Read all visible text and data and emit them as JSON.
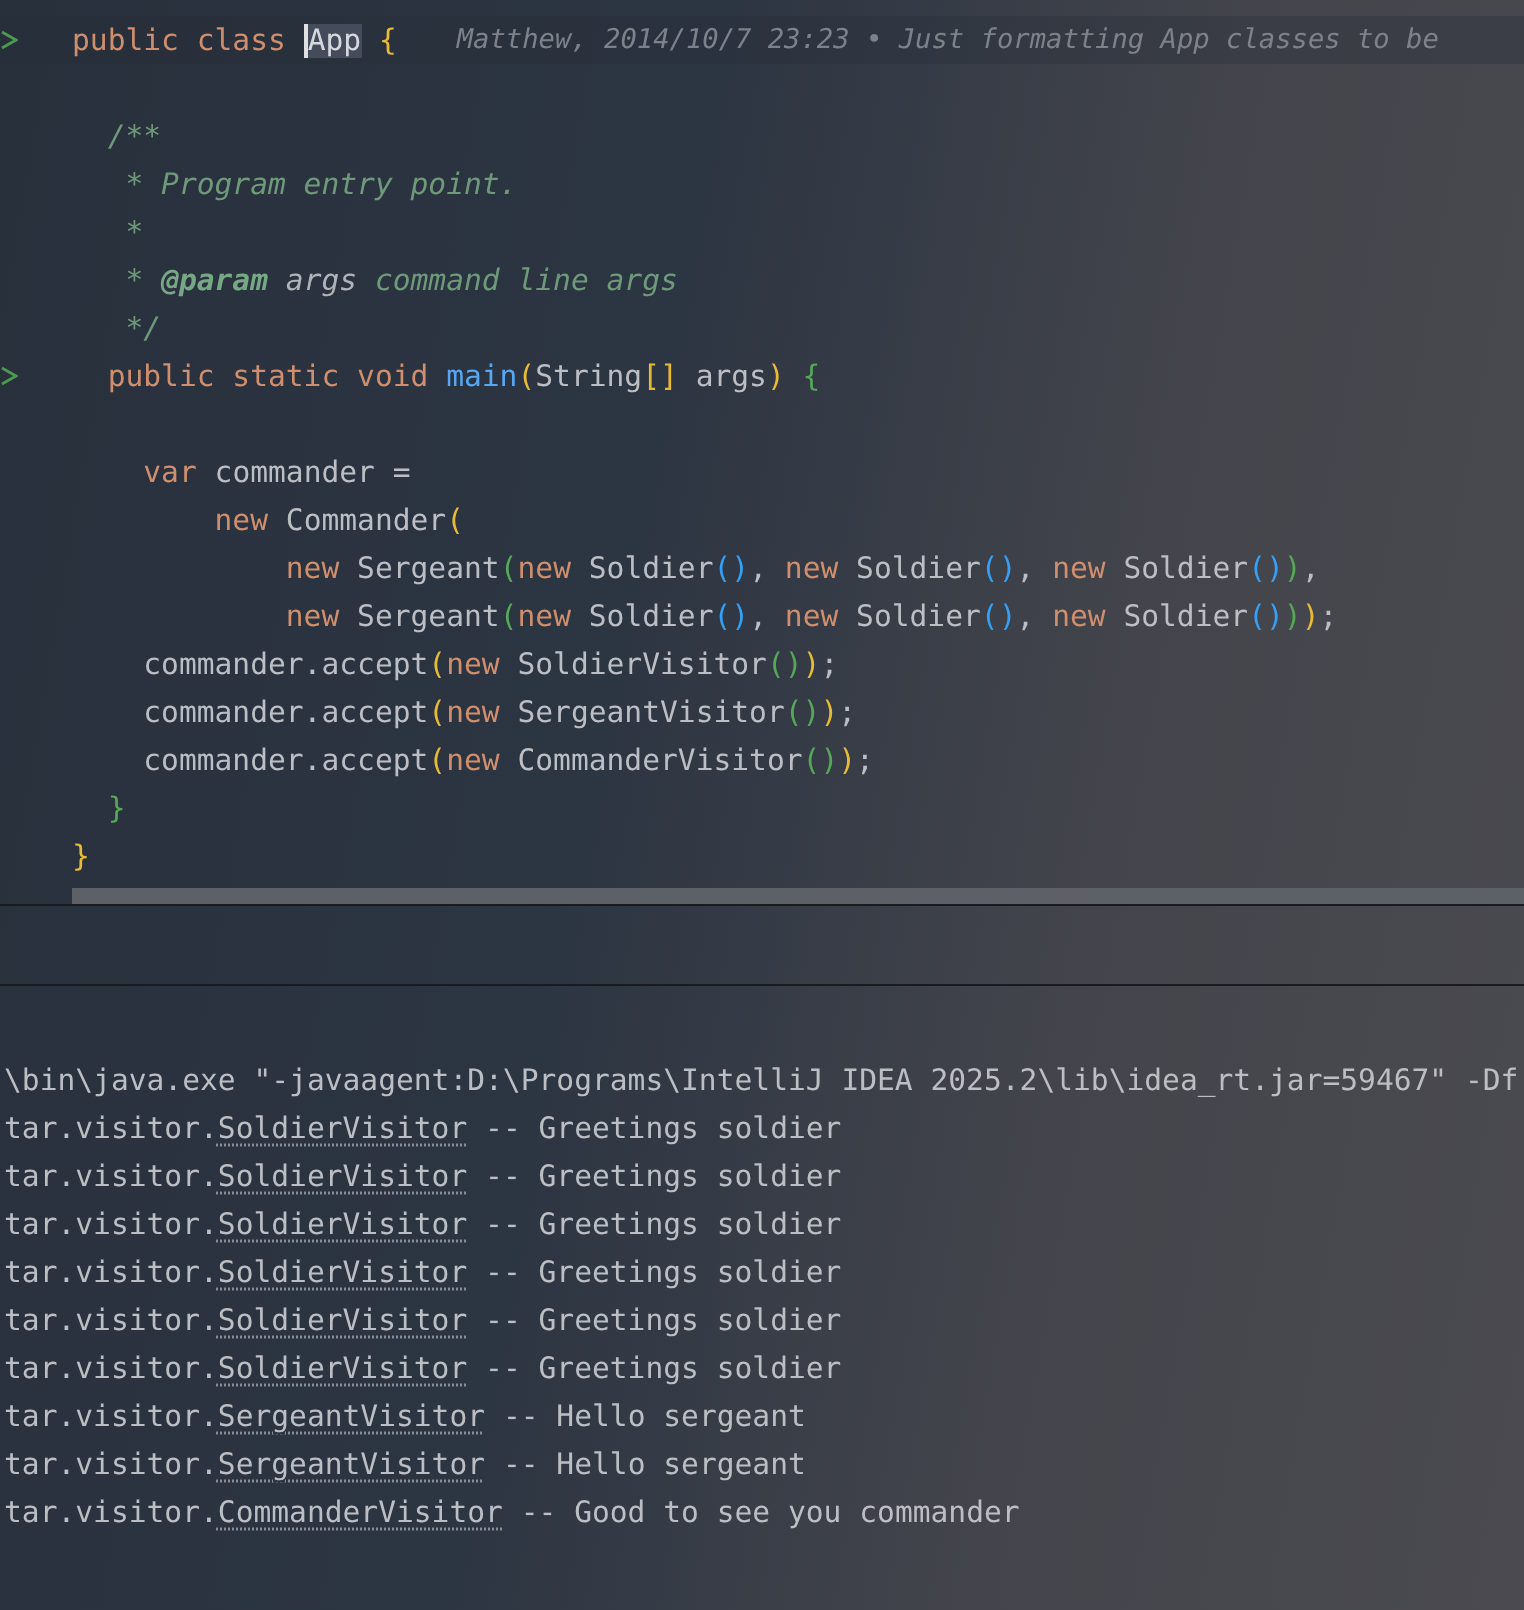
{
  "editor": {
    "lines": [
      {
        "kind": "run-code",
        "tokens": [
          {
            "text": "public class ",
            "kind": "keyword"
          },
          {
            "text": "App",
            "kind": "caret-identifier"
          },
          {
            "text": " {",
            "kind": "bracket-1"
          }
        ],
        "hint": "Matthew, 2014/10/7 23:23 • Just formatting App classes to be"
      },
      {
        "kind": "blank"
      },
      {
        "kind": "code",
        "tokens": [
          {
            "text": "  /**",
            "kind": "doc"
          }
        ]
      },
      {
        "kind": "code",
        "tokens": [
          {
            "text": "   * Program entry point.",
            "kind": "doc"
          }
        ]
      },
      {
        "kind": "code",
        "tokens": [
          {
            "text": "   *",
            "kind": "doc"
          }
        ]
      },
      {
        "kind": "code",
        "tokens": [
          {
            "text": "   * ",
            "kind": "doc"
          },
          {
            "text": "@param",
            "kind": "doc-tag"
          },
          {
            "text": " args",
            "kind": "doc-param"
          },
          {
            "text": " command line args",
            "kind": "doc"
          }
        ]
      },
      {
        "kind": "code",
        "tokens": [
          {
            "text": "   */",
            "kind": "doc"
          }
        ]
      },
      {
        "kind": "run-code",
        "tokens": [
          {
            "text": "  public static void ",
            "kind": "keyword"
          },
          {
            "text": "main",
            "kind": "method"
          },
          {
            "text": "(",
            "kind": "bracket-1"
          },
          {
            "text": "String",
            "kind": "plain"
          },
          {
            "text": "[]",
            "kind": "bracket-1"
          },
          {
            "text": " args",
            "kind": "plain"
          },
          {
            "text": ")",
            "kind": "bracket-1"
          },
          {
            "text": " {",
            "kind": "bracket-2"
          }
        ]
      },
      {
        "kind": "blank"
      },
      {
        "kind": "code",
        "tokens": [
          {
            "text": "    var ",
            "kind": "keyword"
          },
          {
            "text": "commander =",
            "kind": "plain"
          }
        ]
      },
      {
        "kind": "code",
        "tokens": [
          {
            "text": "        new ",
            "kind": "keyword"
          },
          {
            "text": "Commander",
            "kind": "plain"
          },
          {
            "text": "(",
            "kind": "bracket-1"
          }
        ]
      },
      {
        "kind": "code",
        "tokens": [
          {
            "text": "            new ",
            "kind": "keyword"
          },
          {
            "text": "Sergeant",
            "kind": "plain"
          },
          {
            "text": "(",
            "kind": "bracket-2"
          },
          {
            "text": "new ",
            "kind": "keyword"
          },
          {
            "text": "Soldier",
            "kind": "plain"
          },
          {
            "text": "()",
            "kind": "bracket-3"
          },
          {
            "text": ", ",
            "kind": "plain"
          },
          {
            "text": "new ",
            "kind": "keyword"
          },
          {
            "text": "Soldier",
            "kind": "plain"
          },
          {
            "text": "()",
            "kind": "bracket-3"
          },
          {
            "text": ", ",
            "kind": "plain"
          },
          {
            "text": "new ",
            "kind": "keyword"
          },
          {
            "text": "Soldier",
            "kind": "plain"
          },
          {
            "text": "()",
            "kind": "bracket-3"
          },
          {
            "text": ")",
            "kind": "bracket-2"
          },
          {
            "text": ",",
            "kind": "plain"
          }
        ]
      },
      {
        "kind": "code",
        "tokens": [
          {
            "text": "            new ",
            "kind": "keyword"
          },
          {
            "text": "Sergeant",
            "kind": "plain"
          },
          {
            "text": "(",
            "kind": "bracket-2"
          },
          {
            "text": "new ",
            "kind": "keyword"
          },
          {
            "text": "Soldier",
            "kind": "plain"
          },
          {
            "text": "()",
            "kind": "bracket-3"
          },
          {
            "text": ", ",
            "kind": "plain"
          },
          {
            "text": "new ",
            "kind": "keyword"
          },
          {
            "text": "Soldier",
            "kind": "plain"
          },
          {
            "text": "()",
            "kind": "bracket-3"
          },
          {
            "text": ", ",
            "kind": "plain"
          },
          {
            "text": "new ",
            "kind": "keyword"
          },
          {
            "text": "Soldier",
            "kind": "plain"
          },
          {
            "text": "()",
            "kind": "bracket-3"
          },
          {
            "text": ")",
            "kind": "bracket-2"
          },
          {
            "text": ")",
            "kind": "bracket-1"
          },
          {
            "text": ";",
            "kind": "plain"
          }
        ]
      },
      {
        "kind": "code",
        "tokens": [
          {
            "text": "    commander.accept",
            "kind": "plain"
          },
          {
            "text": "(",
            "kind": "bracket-1"
          },
          {
            "text": "new ",
            "kind": "keyword"
          },
          {
            "text": "SoldierVisitor",
            "kind": "plain"
          },
          {
            "text": "()",
            "kind": "bracket-2"
          },
          {
            "text": ")",
            "kind": "bracket-1"
          },
          {
            "text": ";",
            "kind": "plain"
          }
        ]
      },
      {
        "kind": "code",
        "tokens": [
          {
            "text": "    commander.accept",
            "kind": "plain"
          },
          {
            "text": "(",
            "kind": "bracket-1"
          },
          {
            "text": "new ",
            "kind": "keyword"
          },
          {
            "text": "SergeantVisitor",
            "kind": "plain"
          },
          {
            "text": "()",
            "kind": "bracket-2"
          },
          {
            "text": ")",
            "kind": "bracket-1"
          },
          {
            "text": ";",
            "kind": "plain"
          }
        ]
      },
      {
        "kind": "code",
        "tokens": [
          {
            "text": "    commander.accept",
            "kind": "plain"
          },
          {
            "text": "(",
            "kind": "bracket-1"
          },
          {
            "text": "new ",
            "kind": "keyword"
          },
          {
            "text": "CommanderVisitor",
            "kind": "plain"
          },
          {
            "text": "()",
            "kind": "bracket-2"
          },
          {
            "text": ")",
            "kind": "bracket-1"
          },
          {
            "text": ";",
            "kind": "plain"
          }
        ]
      },
      {
        "kind": "code",
        "tokens": [
          {
            "text": "  }",
            "kind": "bracket-2"
          }
        ]
      },
      {
        "kind": "code",
        "tokens": [
          {
            "text": "}",
            "kind": "bracket-1"
          }
        ]
      }
    ]
  },
  "console": {
    "lines": [
      {
        "kind": "command",
        "text": "\\bin\\java.exe \"-javaagent:D:\\Programs\\IntelliJ IDEA 2025.2\\lib\\idea_rt.jar=59467\" -Df"
      },
      {
        "kind": "log",
        "prefix": "tar.visitor.",
        "link": "SoldierVisitor",
        "message": " -- Greetings soldier"
      },
      {
        "kind": "log",
        "prefix": "tar.visitor.",
        "link": "SoldierVisitor",
        "message": " -- Greetings soldier"
      },
      {
        "kind": "log",
        "prefix": "tar.visitor.",
        "link": "SoldierVisitor",
        "message": " -- Greetings soldier"
      },
      {
        "kind": "log",
        "prefix": "tar.visitor.",
        "link": "SoldierVisitor",
        "message": " -- Greetings soldier"
      },
      {
        "kind": "log",
        "prefix": "tar.visitor.",
        "link": "SoldierVisitor",
        "message": " -- Greetings soldier"
      },
      {
        "kind": "log",
        "prefix": "tar.visitor.",
        "link": "SoldierVisitor",
        "message": " -- Greetings soldier"
      },
      {
        "kind": "log",
        "prefix": "tar.visitor.",
        "link": "SergeantVisitor",
        "message": " -- Hello sergeant"
      },
      {
        "kind": "log",
        "prefix": "tar.visitor.",
        "link": "SergeantVisitor",
        "message": " -- Hello sergeant"
      },
      {
        "kind": "log",
        "prefix": "tar.visitor.",
        "link": "CommanderVisitor",
        "message": " -- Good to see you commander"
      }
    ]
  }
}
